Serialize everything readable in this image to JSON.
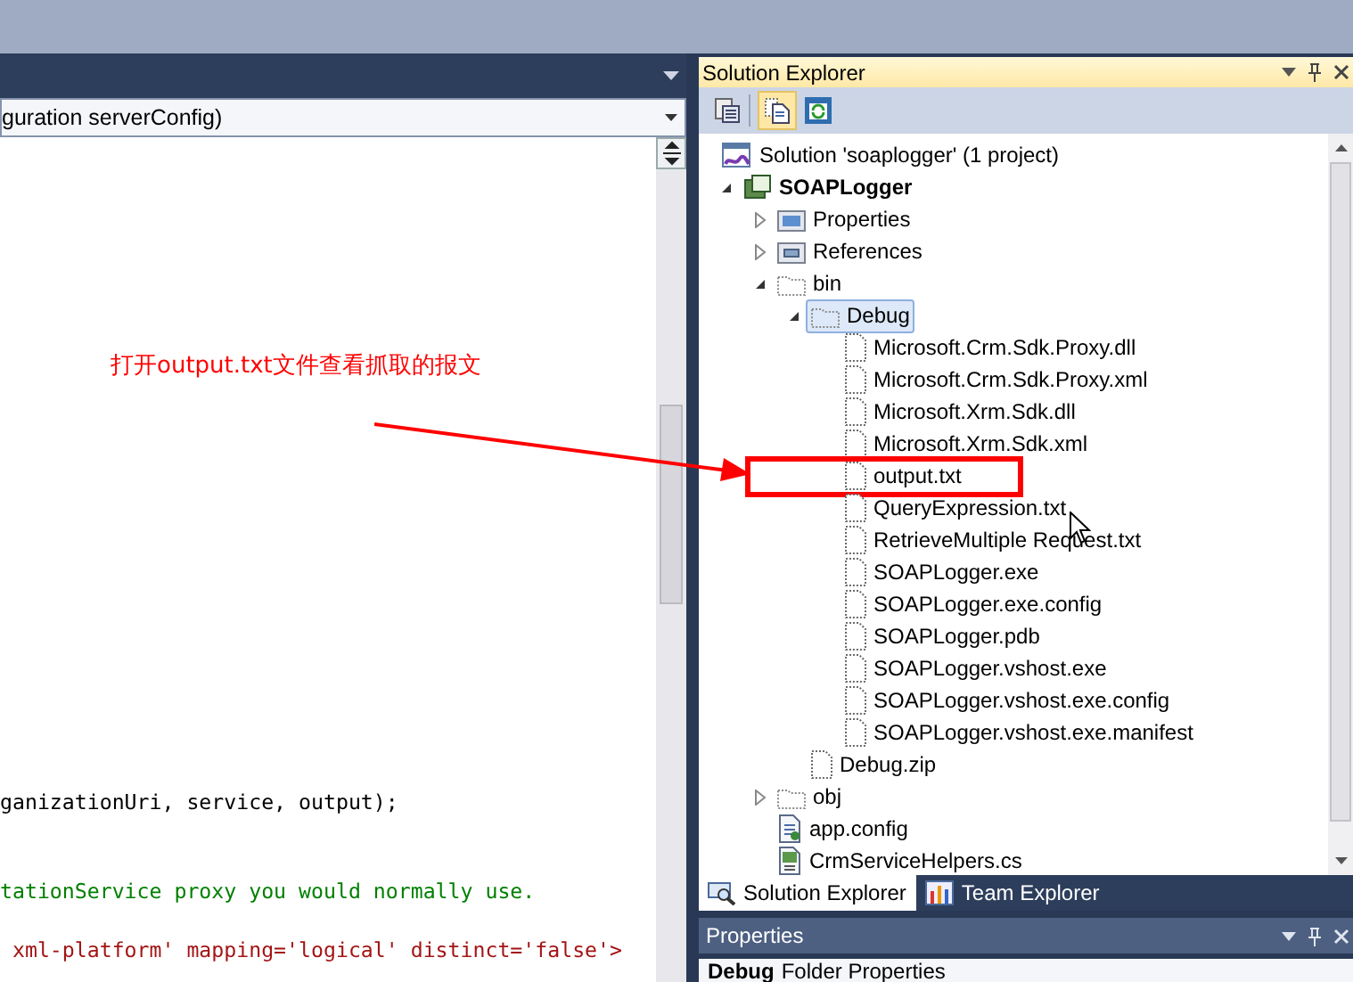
{
  "editor": {
    "member_dropdown": "guration serverConfig)",
    "lines": [
      {
        "kind": "code",
        "text": "ganizationUri, service, output);"
      },
      {
        "kind": "blank"
      },
      {
        "kind": "blank"
      },
      {
        "kind": "comment",
        "text": "tationService proxy you would normally use."
      },
      {
        "kind": "blank"
      },
      {
        "kind": "string",
        "text": " xml-platform' mapping='logical' distinct='false'>"
      }
    ]
  },
  "annotation": {
    "text": "打开output.txt文件查看抓取的报文"
  },
  "solution_explorer": {
    "title": "Solution Explorer",
    "solution": {
      "label": "Solution 'soaplogger' (1 project)",
      "children": [
        {
          "label": "SOAPLogger",
          "kind": "project",
          "expanded": true,
          "selected": false,
          "children": [
            {
              "label": "Properties",
              "kind": "properties",
              "expanded": false,
              "selected": false
            },
            {
              "label": "References",
              "kind": "references",
              "expanded": false,
              "selected": false
            },
            {
              "label": "bin",
              "kind": "folder",
              "expanded": true,
              "selected": false,
              "children": [
                {
                  "label": "Debug",
                  "kind": "folder",
                  "expanded": true,
                  "selected": true,
                  "children": [
                    {
                      "label": "Microsoft.Crm.Sdk.Proxy.dll",
                      "kind": "file",
                      "selected": false
                    },
                    {
                      "label": "Microsoft.Crm.Sdk.Proxy.xml",
                      "kind": "file",
                      "selected": false
                    },
                    {
                      "label": "Microsoft.Xrm.Sdk.dll",
                      "kind": "file",
                      "selected": false
                    },
                    {
                      "label": "Microsoft.Xrm.Sdk.xml",
                      "kind": "file",
                      "selected": false
                    },
                    {
                      "label": "output.txt",
                      "kind": "file",
                      "selected": false,
                      "highlighted": true
                    },
                    {
                      "label": "QueryExpression.txt",
                      "kind": "file",
                      "selected": false
                    },
                    {
                      "label": "RetrieveMultiple Request.txt",
                      "kind": "file",
                      "selected": false
                    },
                    {
                      "label": "SOAPLogger.exe",
                      "kind": "file",
                      "selected": false
                    },
                    {
                      "label": "SOAPLogger.exe.config",
                      "kind": "file",
                      "selected": false
                    },
                    {
                      "label": "SOAPLogger.pdb",
                      "kind": "file",
                      "selected": false
                    },
                    {
                      "label": "SOAPLogger.vshost.exe",
                      "kind": "file",
                      "selected": false
                    },
                    {
                      "label": "SOAPLogger.vshost.exe.config",
                      "kind": "file",
                      "selected": false
                    },
                    {
                      "label": "SOAPLogger.vshost.exe.manifest",
                      "kind": "file",
                      "selected": false
                    }
                  ]
                },
                {
                  "label": "Debug.zip",
                  "kind": "file",
                  "selected": false
                }
              ]
            },
            {
              "label": "obj",
              "kind": "folder",
              "expanded": false,
              "selected": false
            },
            {
              "label": "app.config",
              "kind": "config",
              "selected": false
            },
            {
              "label": "CrmServiceHelpers.cs",
              "kind": "cs",
              "selected": false
            }
          ]
        }
      ]
    },
    "tabs": [
      {
        "label": "Solution Explorer",
        "selected": true
      },
      {
        "label": "Team Explorer",
        "selected": false
      }
    ]
  },
  "properties": {
    "title": "Properties",
    "object_name": "Debug",
    "object_type": "Folder Properties"
  }
}
